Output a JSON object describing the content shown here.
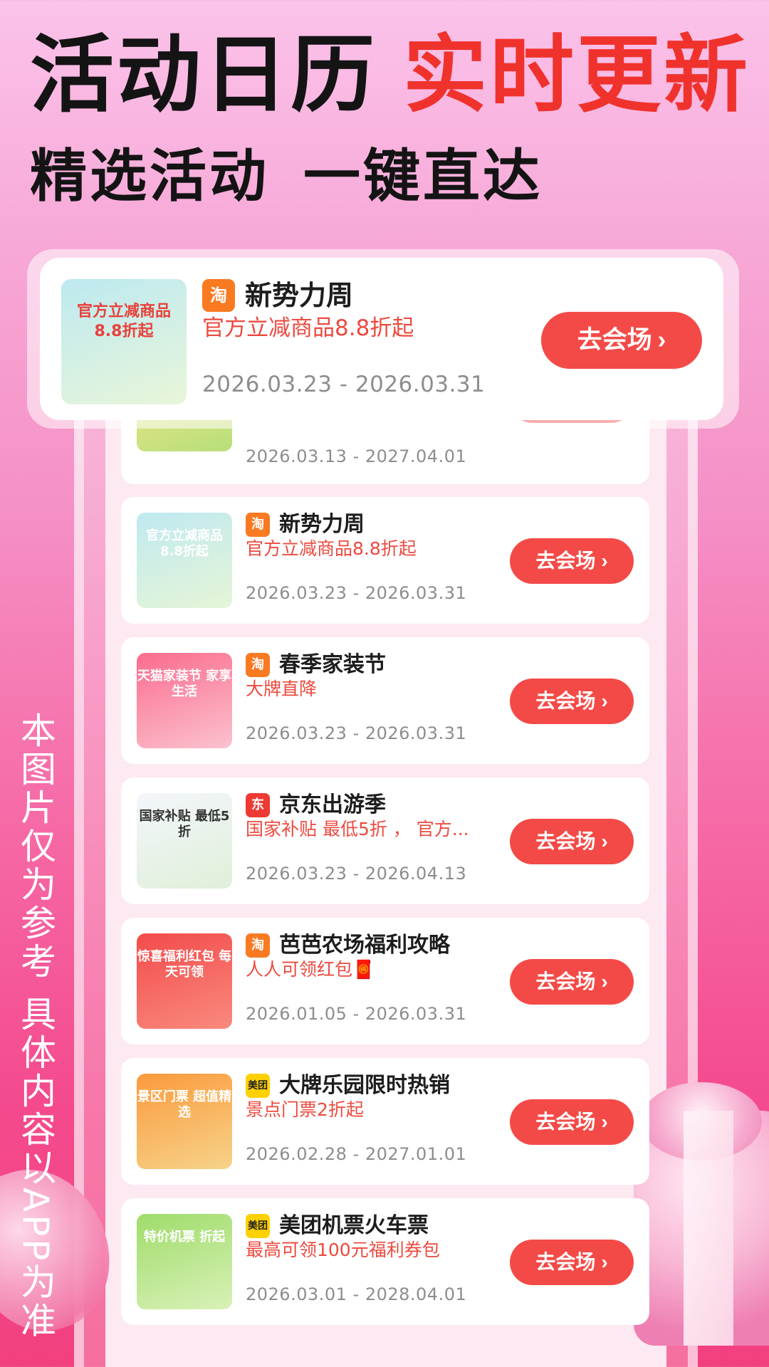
{
  "headline": {
    "black": "活动日历",
    "red": "实时更新"
  },
  "subline": {
    "left": "精选活动",
    "right": "一键直达"
  },
  "disclaimer": "本图片仅为参考 具体内容以APP为准",
  "featured": {
    "brand": "淘",
    "title": "新势力周",
    "subtitle": "官方立减商品8.8折起",
    "dates": "2026.03.23 - 2026.03.31",
    "button": "去会场",
    "thumb_text": "官方立减商品\n8.8折起",
    "thumb_colors": [
      "#bde9f0",
      "#e9f6d9"
    ]
  },
  "partial_card": {
    "dates": "2026.03.13 - 2027.04.01"
  },
  "activities": [
    {
      "brand": "淘",
      "brand_type": "tao",
      "title": "新势力周",
      "subtitle": "官方立减商品8.8折起",
      "dates": "2026.03.23 - 2026.03.31",
      "button": "去会场",
      "thumb_text": "官方立减商品 8.8折起",
      "thumb_colors": [
        "#bfe9f1",
        "#e6f5d6"
      ]
    },
    {
      "brand": "淘",
      "brand_type": "tao",
      "title": "春季家装节",
      "subtitle": "大牌直降",
      "dates": "2026.03.23 - 2026.03.31",
      "button": "去会场",
      "thumb_text": "天猫家装节 家享生活",
      "thumb_colors": [
        "#fb6c8d",
        "#fbc2cf"
      ]
    },
    {
      "brand": "东",
      "brand_type": "jd",
      "title": "京东出游季",
      "subtitle": "国家补贴 最低5折 ， 官方...",
      "dates": "2026.03.23 - 2026.04.13",
      "button": "去会场",
      "thumb_text": "国家补贴 最低5折",
      "thumb_colors": [
        "#f4f6fb",
        "#dff0d9"
      ]
    },
    {
      "brand": "淘",
      "brand_type": "tao",
      "title": "芭芭农场福利攻略",
      "subtitle": "人人可领红包🧧",
      "dates": "2026.01.05 - 2026.03.31",
      "button": "去会场",
      "thumb_text": "惊喜福利红包 每天可领",
      "thumb_colors": [
        "#f34b4b",
        "#f98a7e"
      ]
    },
    {
      "brand": "美团",
      "brand_type": "mt",
      "title": "大牌乐园限时热销",
      "subtitle": "景点门票2折起",
      "dates": "2026.02.28 - 2027.01.01",
      "button": "去会场",
      "thumb_text": "景区门票 超值精选",
      "thumb_colors": [
        "#fb9a3c",
        "#f6d38a"
      ]
    },
    {
      "brand": "美团",
      "brand_type": "mt",
      "title": "美团机票火车票",
      "subtitle": "最高可领100元福利券包",
      "dates": "2026.03.01 - 2028.04.01",
      "button": "去会场",
      "thumb_text": "特价机票 折起",
      "thumb_colors": [
        "#9fdc6a",
        "#d9f1b8"
      ]
    }
  ]
}
